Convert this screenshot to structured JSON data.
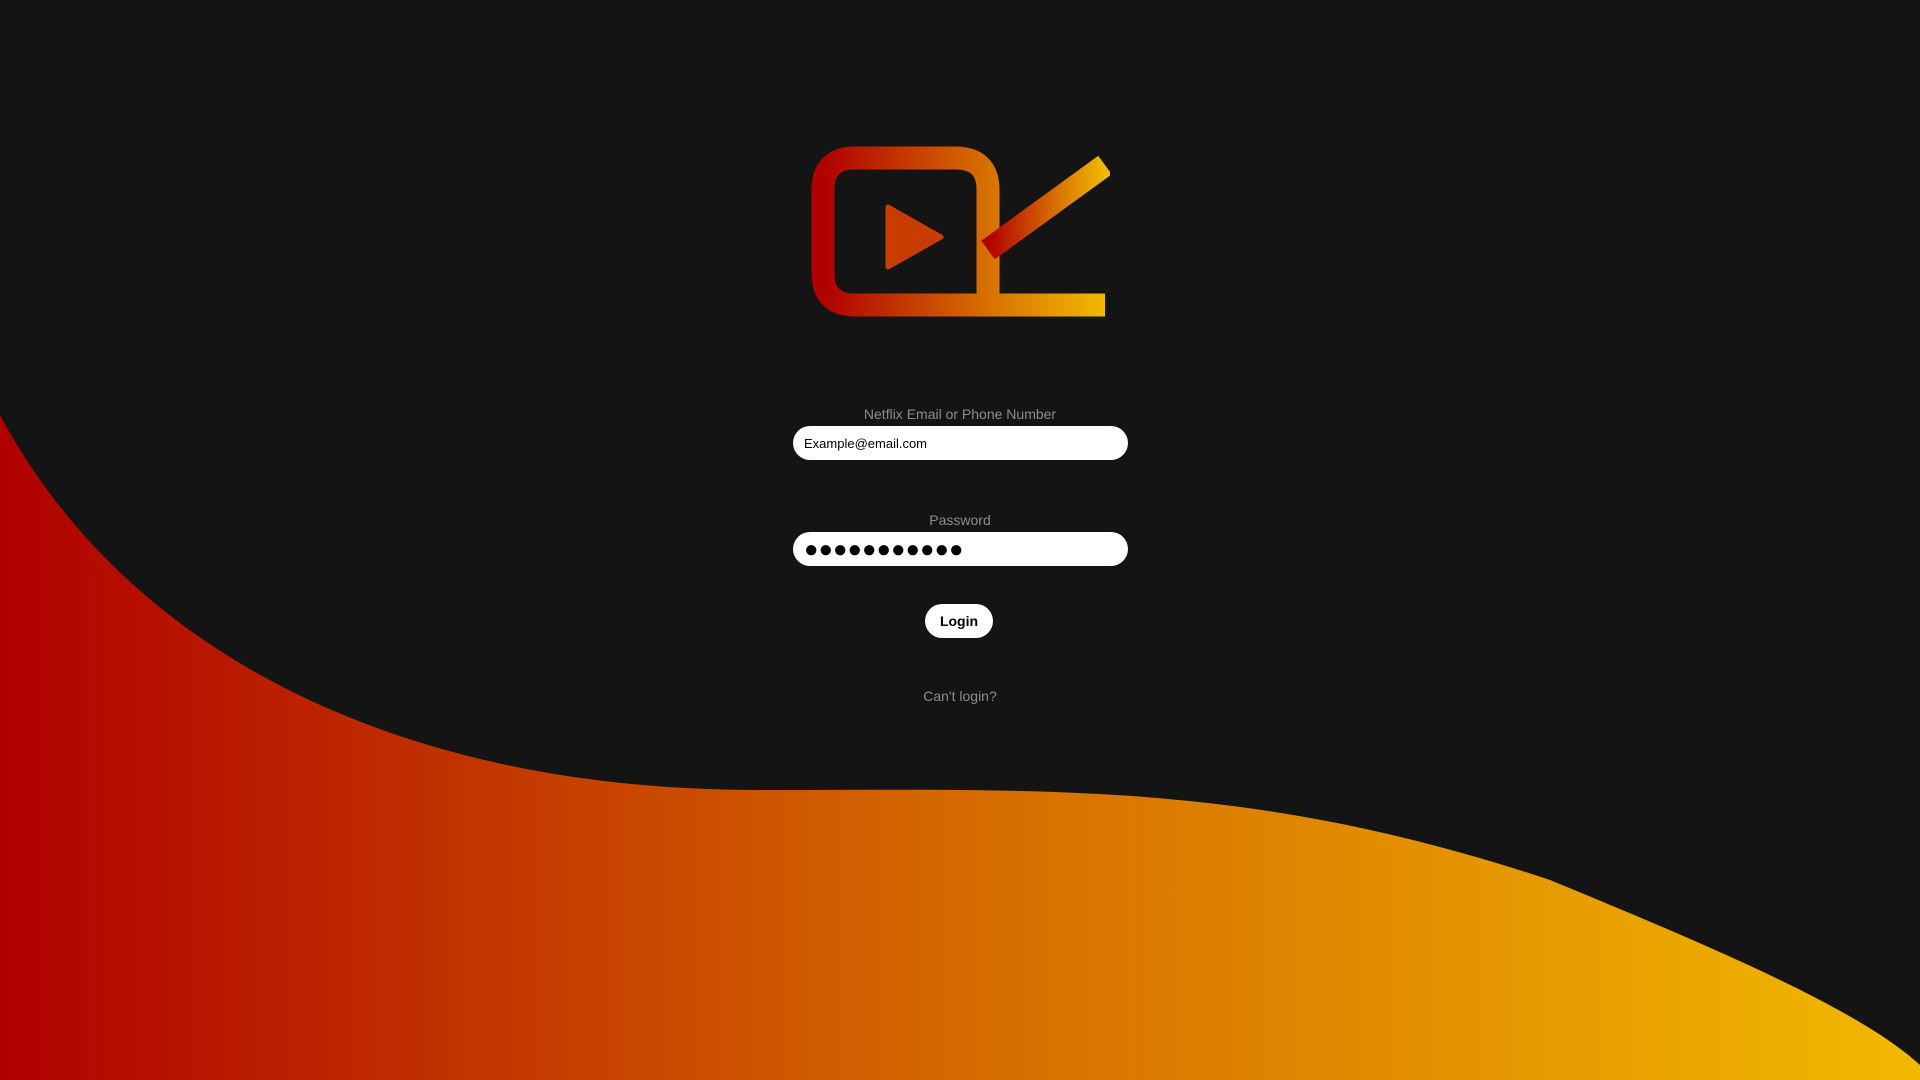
{
  "login_form": {
    "email_label": "Netflix Email or Phone Number",
    "email_value": "Example@email.com",
    "password_label": "Password",
    "password_value": "●●●●●●●●●●●",
    "login_button_label": "Login",
    "cant_login_link": "Can't login?"
  },
  "theme": {
    "background": "#141414",
    "gradient_start": "#b00000",
    "gradient_mid": "#d56a00",
    "gradient_end": "#f2b900",
    "label_color": "#8c8c8c"
  },
  "icons": {
    "logo": "video-play-check-logo"
  }
}
